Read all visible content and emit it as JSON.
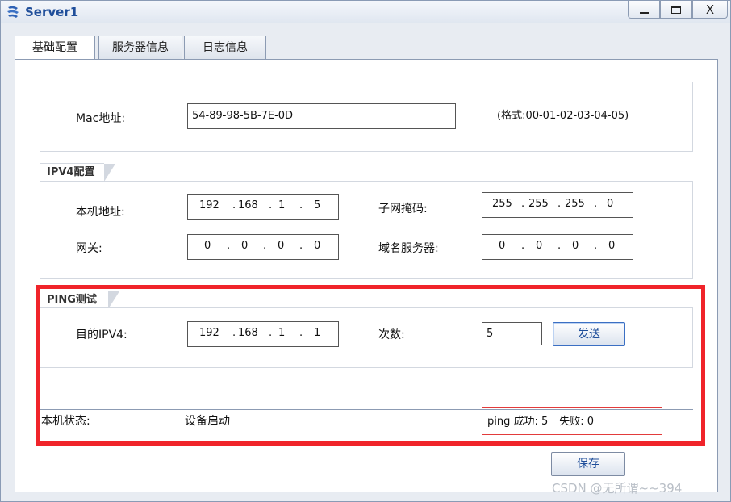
{
  "window": {
    "title": "Server1",
    "controls": {
      "minimize": "minimize-icon",
      "maximize": "maximize-icon",
      "close": "X"
    }
  },
  "tabs": [
    {
      "label": "基础配置",
      "active": true
    },
    {
      "label": "服务器信息",
      "active": false
    },
    {
      "label": "日志信息",
      "active": false
    }
  ],
  "mac": {
    "label": "Mac地址:",
    "value": "54-89-98-5B-7E-0D",
    "format_hint": "(格式:00-01-02-03-04-05)"
  },
  "ipv4": {
    "legend": "IPV4配置",
    "local_address": {
      "label": "本机地址:",
      "octets": [
        "192",
        "168",
        "1",
        "5"
      ]
    },
    "subnet_mask": {
      "label": "子网掩码:",
      "octets": [
        "255",
        "255",
        "255",
        "0"
      ]
    },
    "gateway": {
      "label": "网关:",
      "octets": [
        "0",
        "0",
        "0",
        "0"
      ]
    },
    "dns_server": {
      "label": "域名服务器:",
      "octets": [
        "0",
        "0",
        "0",
        "0"
      ]
    }
  },
  "ping": {
    "legend": "PING测试",
    "dest_label": "目的IPV4:",
    "dest_octets": [
      "192",
      "168",
      "1",
      "1"
    ],
    "count_label": "次数:",
    "count_value": "5",
    "send_label": "发送"
  },
  "status": {
    "label": "本机状态:",
    "value": "设备启动",
    "ping_success": "ping 成功: 5",
    "ping_fail": "失败: 0"
  },
  "save_label": "保存",
  "watermark": "CSDN @无所谓~~394",
  "colors": {
    "highlight_frame": "#f0242a",
    "button_text": "#1f4e9a",
    "title_text": "#1f4e9a"
  }
}
